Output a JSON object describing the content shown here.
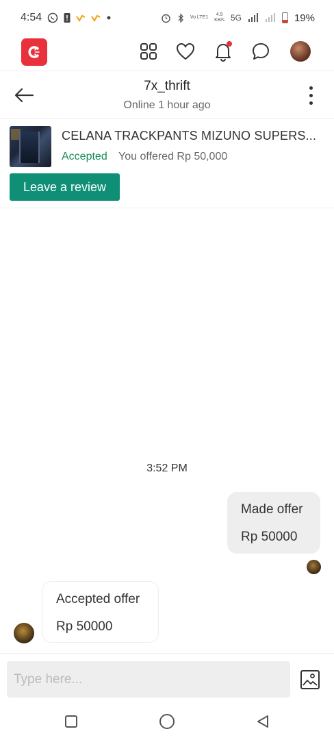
{
  "status_bar": {
    "time": "4:54",
    "network_speed_value": "4.9",
    "network_speed_unit": "KB/s",
    "volte_label": "Vo LTE1",
    "network_type": "5G",
    "battery": "19%"
  },
  "app_bar": {
    "icons": [
      "carousell-logo-icon",
      "grid-icon",
      "heart-icon",
      "bell-icon",
      "chat-icon",
      "profile-avatar"
    ],
    "notification_dot_color": "#e8313d",
    "brand_color": "#e8313d"
  },
  "chat_header": {
    "title": "7x_thrift",
    "subtitle": "Online 1 hour ago"
  },
  "product": {
    "title": "CELANA TRACKPANTS MIZUNO SUPERS...",
    "status": "Accepted",
    "status_color": "#1a8a5a",
    "offer_text": "You offered Rp 50,000",
    "review_button": "Leave a review",
    "review_button_color": "#0e8f76"
  },
  "messages": {
    "timestamp": "3:52 PM",
    "outgoing": {
      "line1": "Made offer",
      "line2": "Rp 50000"
    },
    "incoming": {
      "line1": "Accepted offer",
      "line2": "Rp 50000"
    }
  },
  "composer": {
    "placeholder": "Type here..."
  },
  "nav_bar": {
    "buttons": [
      "recents-square-icon",
      "home-circle-icon",
      "back-triangle-icon"
    ]
  }
}
